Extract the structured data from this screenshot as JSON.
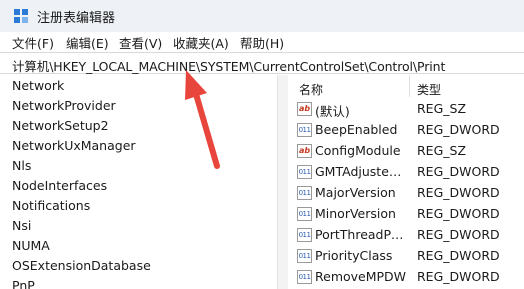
{
  "window": {
    "title": "注册表编辑器"
  },
  "menu": [
    {
      "label": "文件(F)"
    },
    {
      "label": "编辑(E)"
    },
    {
      "label": "查看(V)"
    },
    {
      "label": "收藏夹(A)"
    },
    {
      "label": "帮助(H)"
    }
  ],
  "address": {
    "path": "计算机\\HKEY_LOCAL_MACHINE\\SYSTEM\\CurrentControlSet\\Control\\Print"
  },
  "tree": {
    "items": [
      {
        "label": "Network"
      },
      {
        "label": "NetworkProvider"
      },
      {
        "label": "NetworkSetup2"
      },
      {
        "label": "NetworkUxManager"
      },
      {
        "label": "Nls"
      },
      {
        "label": "NodeInterfaces"
      },
      {
        "label": "Notifications"
      },
      {
        "label": "Nsi"
      },
      {
        "label": "NUMA"
      },
      {
        "label": "OSExtensionDatabase"
      },
      {
        "label": "PnP"
      }
    ]
  },
  "values": {
    "headers": {
      "name": "名称",
      "type": "类型"
    },
    "rows": [
      {
        "icon": "string-value-icon",
        "icon_glyph": "ab",
        "name": "(默认)",
        "type": "REG_SZ"
      },
      {
        "icon": "binary-value-icon",
        "icon_glyph": "011",
        "name": "BeepEnabled",
        "type": "REG_DWORD"
      },
      {
        "icon": "string-value-icon",
        "icon_glyph": "ab",
        "name": "ConfigModule",
        "type": "REG_SZ"
      },
      {
        "icon": "binary-value-icon",
        "icon_glyph": "011",
        "name": "GMTAdjustedF...",
        "type": "REG_DWORD"
      },
      {
        "icon": "binary-value-icon",
        "icon_glyph": "011",
        "name": "MajorVersion",
        "type": "REG_DWORD"
      },
      {
        "icon": "binary-value-icon",
        "icon_glyph": "011",
        "name": "MinorVersion",
        "type": "REG_DWORD"
      },
      {
        "icon": "binary-value-icon",
        "icon_glyph": "011",
        "name": "PortThreadPri...",
        "type": "REG_DWORD"
      },
      {
        "icon": "binary-value-icon",
        "icon_glyph": "011",
        "name": "PriorityClass",
        "type": "REG_DWORD"
      },
      {
        "icon": "binary-value-icon",
        "icon_glyph": "011",
        "name": "RemoveMPDW",
        "type": "REG_DWORD"
      }
    ]
  },
  "colors": {
    "annotation_arrow": "#e8453c",
    "app_icon": "#2b7bd6"
  }
}
